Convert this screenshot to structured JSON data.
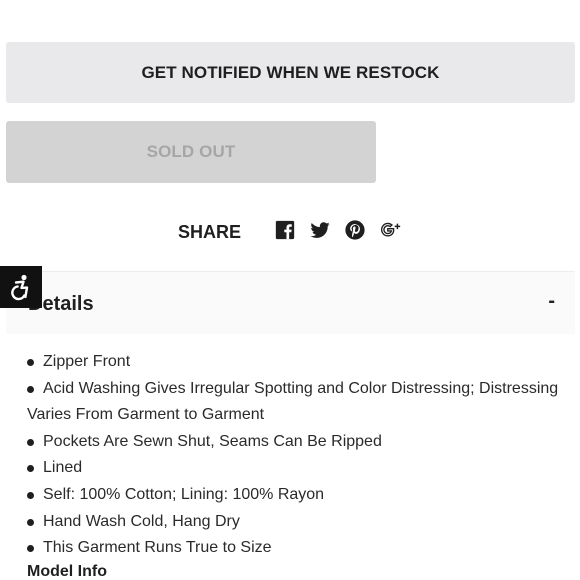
{
  "buttons": {
    "notify_label": "GET NOTIFIED WHEN WE RESTOCK",
    "soldout_label": "SOLD OUT"
  },
  "share": {
    "label": "SHARE",
    "icons": [
      "facebook-icon",
      "twitter-icon",
      "pinterest-icon",
      "google-plus-icon"
    ]
  },
  "details": {
    "title": "Details",
    "toggle": "-",
    "items": [
      "Zipper Front",
      "Acid Washing Gives Irregular Spotting and Color Distressing; Distressing Varies From Garment to Garment",
      "Pockets Are Sewn Shut, Seams Can Be Ripped",
      "Lined",
      "Self: 100% Cotton; Lining: 100% Rayon",
      "Hand Wash Cold, Hang Dry",
      "This Garment Runs True to Size"
    ],
    "model_info_label": "Model Info"
  },
  "colors": {
    "notify_bg": "#e9e9eb",
    "soldout_bg": "#d3d3d3",
    "soldout_text": "#a6a6a6",
    "accessibility_bg": "#111111"
  }
}
